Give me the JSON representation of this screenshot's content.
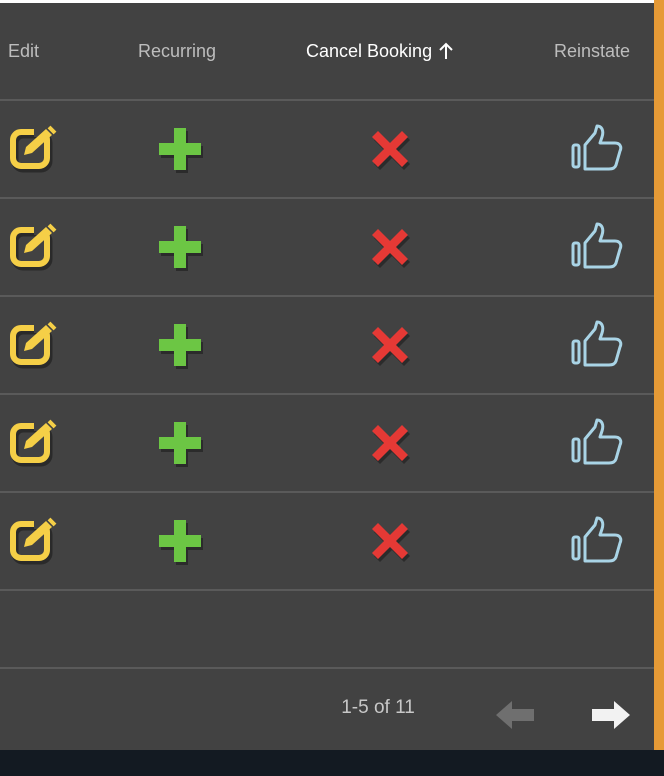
{
  "table": {
    "columns": [
      {
        "label": "Edit"
      },
      {
        "label": "Recurring"
      },
      {
        "label": "Cancel Booking",
        "sorted": "ascending"
      },
      {
        "label": "Reinstate"
      }
    ],
    "rows": [
      {
        "edit_icon": "edit-icon",
        "recurring_icon": "plus-icon",
        "cancel_icon": "cross-icon",
        "reinstate_icon": "thumbs-up-icon"
      },
      {
        "edit_icon": "edit-icon",
        "recurring_icon": "plus-icon",
        "cancel_icon": "cross-icon",
        "reinstate_icon": "thumbs-up-icon"
      },
      {
        "edit_icon": "edit-icon",
        "recurring_icon": "plus-icon",
        "cancel_icon": "cross-icon",
        "reinstate_icon": "thumbs-up-icon"
      },
      {
        "edit_icon": "edit-icon",
        "recurring_icon": "plus-icon",
        "cancel_icon": "cross-icon",
        "reinstate_icon": "thumbs-up-icon"
      },
      {
        "edit_icon": "edit-icon",
        "recurring_icon": "plus-icon",
        "cancel_icon": "cross-icon",
        "reinstate_icon": "thumbs-up-icon"
      }
    ]
  },
  "pagination": {
    "range_text": "1-5 of 11",
    "prev_enabled": false,
    "next_enabled": true
  },
  "colors": {
    "panel_bg": "#424242",
    "divider": "#5a5a5a",
    "edit_icon": "#f5cf47",
    "plus_icon": "#6cc644",
    "cross_icon": "#e53935",
    "thumbs_icon": "#a9d4e6",
    "accent_right": "#e69a36"
  }
}
